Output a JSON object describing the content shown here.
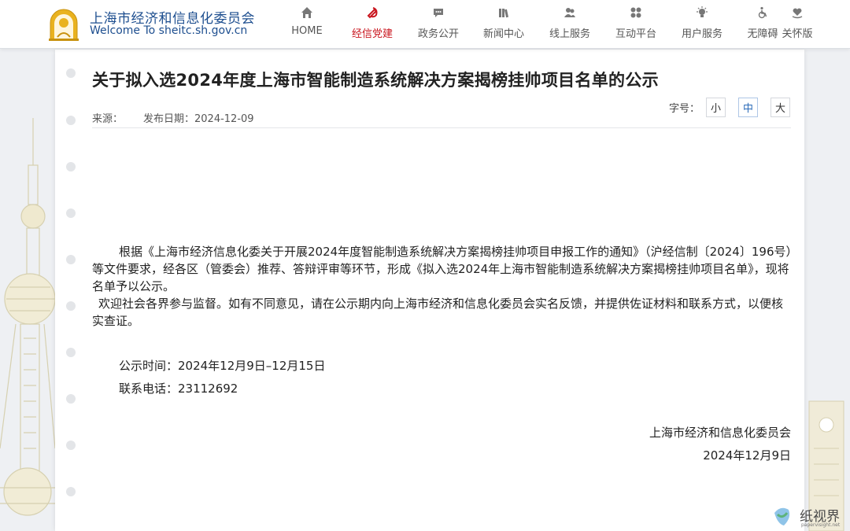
{
  "site": {
    "title": "上海市经济和信息化委员会",
    "subtitle": "Welcome To sheitc.sh.gov.cn",
    "brand_color": "#1d4e8f",
    "logo": "shanghai-emblem-logo"
  },
  "nav": [
    {
      "label": "HOME",
      "icon": "home-icon"
    },
    {
      "label": "经信党建",
      "icon": "party-emblem-icon",
      "active": true,
      "color": "#c9151e"
    },
    {
      "label": "政务公开",
      "icon": "speech-bubble-icon"
    },
    {
      "label": "新闻中心",
      "icon": "books-icon"
    },
    {
      "label": "线上服务",
      "icon": "users-icon"
    },
    {
      "label": "互动平台",
      "icon": "grid-icon"
    },
    {
      "label": "用户服务",
      "icon": "lightbulb-icon"
    },
    {
      "label": "无障碍",
      "icon": "wheelchair-icon"
    },
    {
      "label": "关怀版",
      "icon": "heart-hand-icon"
    }
  ],
  "article": {
    "title": "关于拟入选2024年度上海市智能制造系统解决方案揭榜挂帅项目名单的公示",
    "source_label": "来源：",
    "date_label": "发布日期：2024-12-09",
    "font_size_label": "字号：",
    "font_sizes": [
      "小",
      "中",
      "大"
    ],
    "selected_font_size": "中",
    "paragraphs": [
      "根据《上海市经济信息化委关于开展2024年度智能制造系统解决方案揭榜挂帅项目申报工作的通知》（沪经信制〔2024〕196号）等文件要求，经各区（管委会）推荐、答辩评审等环节，形成《拟入选2024年上海市智能制造系统解决方案揭榜挂帅项目名单》，现将名单予以公示。",
      "欢迎社会各界参与监督。如有不同意见，请在公示期内向上海市经济和信息化委员会实名反馈，并提供佐证材料和联系方式，以便核实查证。"
    ],
    "notice_period": "公示时间：2024年12月9日–12月15日",
    "contact_phone": "联系电话：23112692",
    "signature_org": "上海市经济和信息化委员会",
    "signature_date": "2024年12月9日"
  },
  "watermark": {
    "text": "纸视界",
    "url": "papervisight.net"
  }
}
